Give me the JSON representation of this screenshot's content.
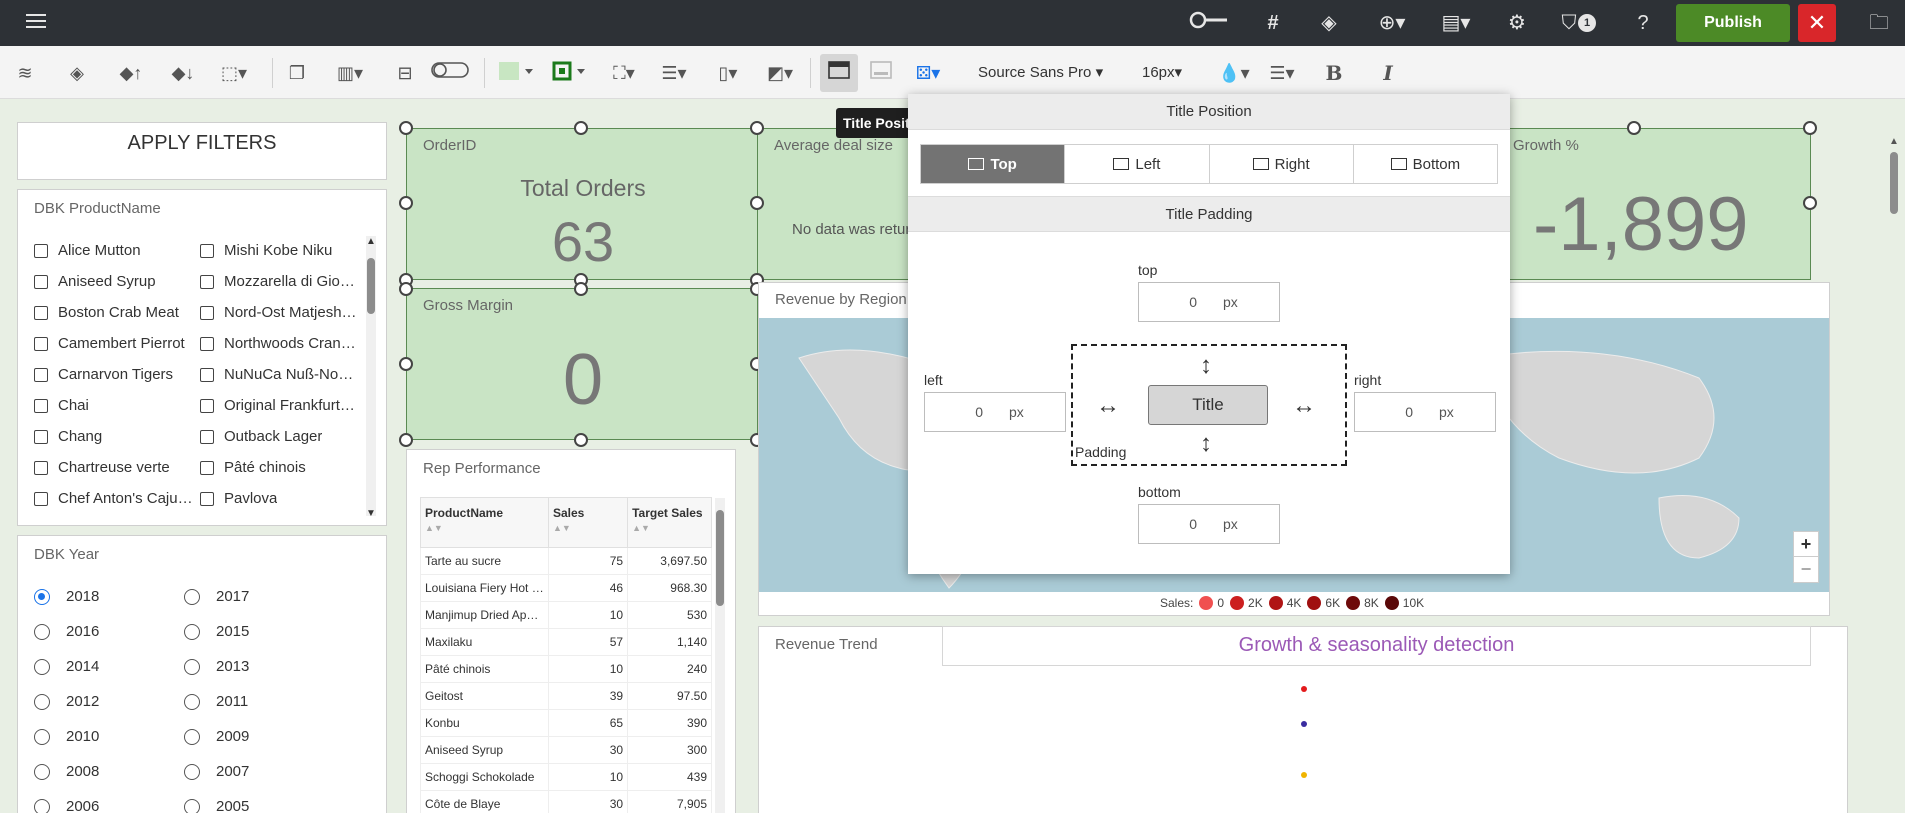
{
  "topbar": {
    "publish_label": "Publish",
    "filter_badge": "1",
    "icons": [
      "menu-icon",
      "toggle-slider-icon",
      "hash-icon",
      "diamond-icon",
      "add-circle-icon",
      "report-icon",
      "settings-icon",
      "filter-icon",
      "help-icon",
      "close-icon",
      "folder-icon"
    ]
  },
  "toolbar": {
    "font_family": "Source Sans Pro",
    "font_size": "16px",
    "bold_label": "B",
    "italic_label": "I"
  },
  "tooltip": "Title Position",
  "filters": {
    "apply_label": "APPLY FILTERS",
    "product_panel_title": "DBK ProductName",
    "products_col1": [
      "Alice Mutton",
      "Aniseed Syrup",
      "Boston Crab Meat",
      "Camembert Pierrot",
      "Carnarvon Tigers",
      "Chai",
      "Chang",
      "Chartreuse verte",
      "Chef Anton's Cajun Seasoning"
    ],
    "products_col2": [
      "Mishi Kobe Niku",
      "Mozzarella di Giovanni",
      "Nord-Ost Matjeshering",
      "Northwoods Cranberry Sauce",
      "NuNuCa Nuß-Nougat-Creme",
      "Original Frankfurter grüne Soße",
      "Outback Lager",
      "Pâté chinois",
      "Pavlova"
    ],
    "year_panel_title": "DBK Year",
    "years_col1": [
      "2018",
      "2016",
      "2014",
      "2012",
      "2010",
      "2008",
      "2006"
    ],
    "years_col2": [
      "2017",
      "2015",
      "2013",
      "2011",
      "2009",
      "2007",
      "2005"
    ],
    "selected_year": "2018"
  },
  "kpis": {
    "orders_label": "OrderID",
    "orders_title": "Total Orders",
    "orders_value": "63",
    "deal_label": "Average deal size",
    "deal_nodata": "No data was returned",
    "growth_label": "Growth %",
    "growth_value": "-1,899",
    "margin_label": "Gross Margin",
    "margin_value": "0"
  },
  "rep": {
    "title": "Rep Performance",
    "columns": [
      "ProductName",
      "Sales",
      "Target Sales"
    ],
    "rows": [
      [
        "Tarte au sucre",
        "75",
        "3,697.50"
      ],
      [
        "Louisiana Fiery Hot Pepper Sauce",
        "46",
        "968.30"
      ],
      [
        "Manjimup Dried Apples",
        "10",
        "530"
      ],
      [
        "Maxilaku",
        "57",
        "1,140"
      ],
      [
        "Pâté chinois",
        "10",
        "240"
      ],
      [
        "Geitost",
        "39",
        "97.50"
      ],
      [
        "Konbu",
        "65",
        "390"
      ],
      [
        "Aniseed Syrup",
        "30",
        "300"
      ],
      [
        "Schoggi Schokolade",
        "10",
        "439"
      ],
      [
        "Côte de Blaye",
        "30",
        "7,905"
      ]
    ]
  },
  "region": {
    "title": "Revenue by Region",
    "zoom_in": "+",
    "zoom_out": "−",
    "legend_label": "Sales:",
    "legend": [
      {
        "label": "0",
        "color": "#f05050"
      },
      {
        "label": "2K",
        "color": "#cc1f1f"
      },
      {
        "label": "4K",
        "color": "#b01515"
      },
      {
        "label": "6K",
        "color": "#a01010"
      },
      {
        "label": "8K",
        "color": "#6e0a0a"
      },
      {
        "label": "10K",
        "color": "#5a0808"
      }
    ]
  },
  "trend": {
    "title": "Revenue Trend",
    "chart_title": "Growth & seasonality detection"
  },
  "popup": {
    "position_header": "Title Position",
    "options": [
      "Top",
      "Left",
      "Right",
      "Bottom"
    ],
    "selected": "Top",
    "padding_header": "Title Padding",
    "top_label": "top",
    "left_label": "left",
    "right_label": "right",
    "bottom_label": "bottom",
    "top_value": "0",
    "left_value": "0",
    "right_value": "0",
    "bottom_value": "0",
    "unit": "px",
    "preview_label": "Title",
    "padding_caption": "Padding"
  }
}
